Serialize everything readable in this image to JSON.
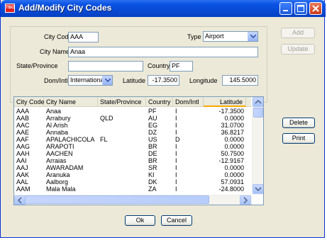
{
  "window": {
    "title": "Add/Modify City Codes",
    "icon_text": "TBO"
  },
  "form": {
    "city_code_label": "City Code",
    "city_code_value": "AAA",
    "type_label": "Type",
    "type_value": "Airport",
    "city_name_label": "City Name",
    "city_name_value": "Anaa",
    "state_label": "State/Province",
    "state_value": "",
    "country_label": "Country",
    "country_value": "PF",
    "dom_intl_label": "Dom/Intl",
    "dom_intl_value": "International",
    "latitude_label": "Latitude",
    "latitude_value": "-17.3500",
    "longitude_label": "Longitude",
    "longitude_value": "145.5000"
  },
  "buttons": {
    "add": "Add",
    "update": "Update",
    "delete": "Delete",
    "print": "Print",
    "ok": "Ok",
    "cancel": "Cancel"
  },
  "table": {
    "headers": [
      "City Code",
      "City Name",
      "State/Province",
      "Country",
      "Dom/Intl",
      "Latitude"
    ],
    "sorted_column": "Latitude",
    "rows": [
      [
        "AAA",
        "Anaa",
        "",
        "PF",
        "I",
        "-17.3500"
      ],
      [
        "AAB",
        "Arrabury",
        "QLD",
        "AU",
        "I",
        "0.0000"
      ],
      [
        "AAC",
        "Al Arish",
        "",
        "EG",
        "I",
        "31.0700"
      ],
      [
        "AAE",
        "Annaba",
        "",
        "DZ",
        "I",
        "36.8217"
      ],
      [
        "AAF",
        "APALACHICOLA",
        "FL",
        "US",
        "D",
        "0.0000"
      ],
      [
        "AAG",
        "ARAPOTI",
        "",
        "BR",
        "I",
        "0.0000"
      ],
      [
        "AAH",
        "AACHEN",
        "",
        "DE",
        "I",
        "50.7500"
      ],
      [
        "AAI",
        "Arraias",
        "",
        "BR",
        "I",
        "-12.9167"
      ],
      [
        "AAJ",
        "AWARADAM",
        "",
        "SR",
        "I",
        "0.0000"
      ],
      [
        "AAK",
        "Aranuka",
        "",
        "KI",
        "I",
        "0.0000"
      ],
      [
        "AAL",
        "Aalborg",
        "",
        "DK",
        "I",
        "57.0931"
      ],
      [
        "AAM",
        "Mala Mala",
        "",
        "ZA",
        "I",
        "-24.8000"
      ]
    ]
  },
  "icons": [
    "minimize-icon",
    "maximize-icon",
    "close-icon",
    "dropdown-arrow-icon",
    "scroll-up-icon",
    "scroll-down-icon",
    "scroll-left-icon",
    "scroll-right-icon"
  ]
}
